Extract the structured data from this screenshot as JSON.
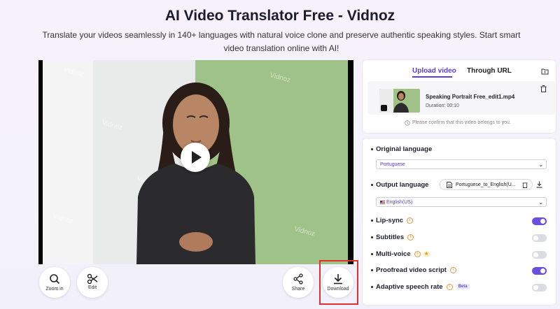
{
  "page": {
    "title": "AI Video Translator Free - Vidnoz",
    "subtitle": "Translate your videos seamlessly in 140+ languages with natural voice clone and preserve authentic speaking styles. Start smart video translation online with AI!"
  },
  "video": {
    "watermark": "Vidnoz"
  },
  "tools": {
    "zoom_label": "Zoom in",
    "edit_label": "Edit",
    "share_label": "Share",
    "download_label": "Download"
  },
  "upload": {
    "tab_upload": "Upload video",
    "tab_url": "Through URL",
    "file_name": "Speaking Portrait Free_edit1.mp4",
    "duration": "Duration:  00:10",
    "confirm_note": "Please confirm that this video belongs to you."
  },
  "settings": {
    "original_language_label": "Original language",
    "original_language_value": "Portuguese",
    "output_language_label": "Output language",
    "script_file": "Portuguese_to_English(U...",
    "output_language_value": "English(US)",
    "options": [
      {
        "label": "Lip-sync",
        "on": true
      },
      {
        "label": "Subtitles",
        "on": false
      },
      {
        "label": "Multi-voice",
        "on": false
      },
      {
        "label": "Proofread video script",
        "on": true
      },
      {
        "label": "Adaptive speech rate",
        "on": false,
        "badge": "Beta"
      }
    ]
  },
  "colors": {
    "accent": "#5b3fd6",
    "highlight_border": "#e03030"
  }
}
